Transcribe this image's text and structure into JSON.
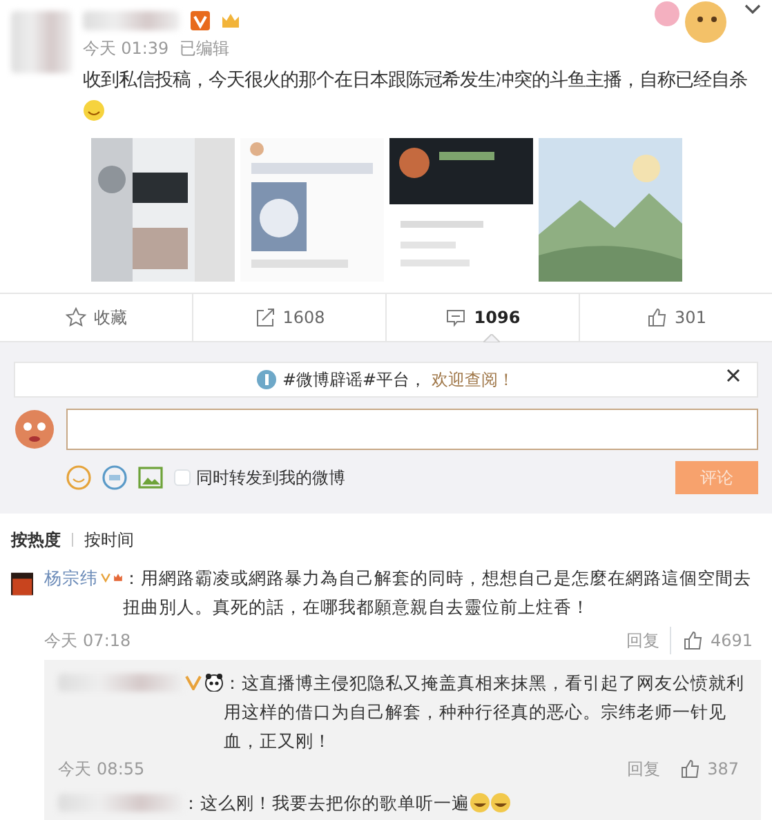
{
  "post": {
    "time": "今天 01:39",
    "edited": "已编辑",
    "text": "收到私信投稿，今天很火的那个在日本跟陈冠希发生冲突的斗鱼主播，自称已经自杀"
  },
  "actions": [
    {
      "kind": "favorite",
      "label": "收藏",
      "selected": false
    },
    {
      "kind": "repost",
      "label": "1608",
      "selected": false
    },
    {
      "kind": "comment",
      "label": "1096",
      "selected": true
    },
    {
      "kind": "like",
      "label": "301",
      "selected": false
    }
  ],
  "notice": {
    "text": "#微博辟谣#平台，",
    "link": "欢迎查阅！"
  },
  "compose": {
    "repost_label": "同时转发到我的微博",
    "checked": false,
    "button": "评论"
  },
  "sort": [
    {
      "label": "按热度",
      "selected": true
    },
    {
      "label": "按时间",
      "selected": false
    }
  ],
  "comments": [
    {
      "author": "杨宗纬",
      "text": "：用網路霸凌或網路暴力為自己解套的同時，想想自己是怎麼在網路這個空間去扭曲別人。真死的話，在哪我都願意親自去靈位前上炷香！",
      "time": "今天 07:18",
      "reply": "回复",
      "likes": "4691",
      "replies": [
        {
          "text": "：这直播博主侵犯隐私又掩盖真相来抹黑，看引起了网友公愤就利用这样的借口为自己解套，种种行径真的恶心。宗纬老师一针见血，正又刚！",
          "time": "今天 08:55",
          "reply": "回复",
          "likes": "387"
        },
        {
          "text": "：这么刚！我要去把你的歌单听一遍"
        }
      ]
    }
  ]
}
